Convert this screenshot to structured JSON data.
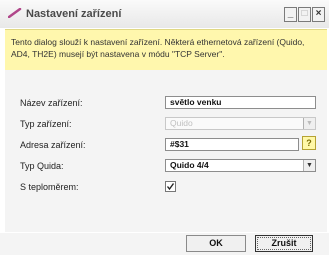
{
  "window": {
    "title": "Nastavení zařízení",
    "buttons": {
      "minimize": "_",
      "maximize": "□",
      "close": "×"
    }
  },
  "notice": {
    "text": "Tento dialog slouží k nastavení zařízení. Některá ethernetová zařízení (Quido, AD4, TH2E) musejí být nastavena v módu \"TCP Server\"."
  },
  "form": {
    "name_label": "Název zařízení:",
    "name_value": "světlo venku",
    "type_label": "Typ zařízení:",
    "type_value": "Quido",
    "address_label": "Adresa zařízení:",
    "address_value": "#$31",
    "help_label": "?",
    "quido_type_label": "Typ Quida:",
    "quido_type_value": "Quido 4/4",
    "thermo_label": "S teploměrem:",
    "thermo_checked": true,
    "dropdown_arrow": "▼"
  },
  "footer": {
    "ok_label": "OK",
    "cancel_label": "Zrušit"
  },
  "colors": {
    "notice_bg": "#fff7ad",
    "title_icon": "#b0478a"
  },
  "icons": {
    "title": "pencil-icon",
    "help": "help-icon",
    "check": "checkmark-icon"
  }
}
